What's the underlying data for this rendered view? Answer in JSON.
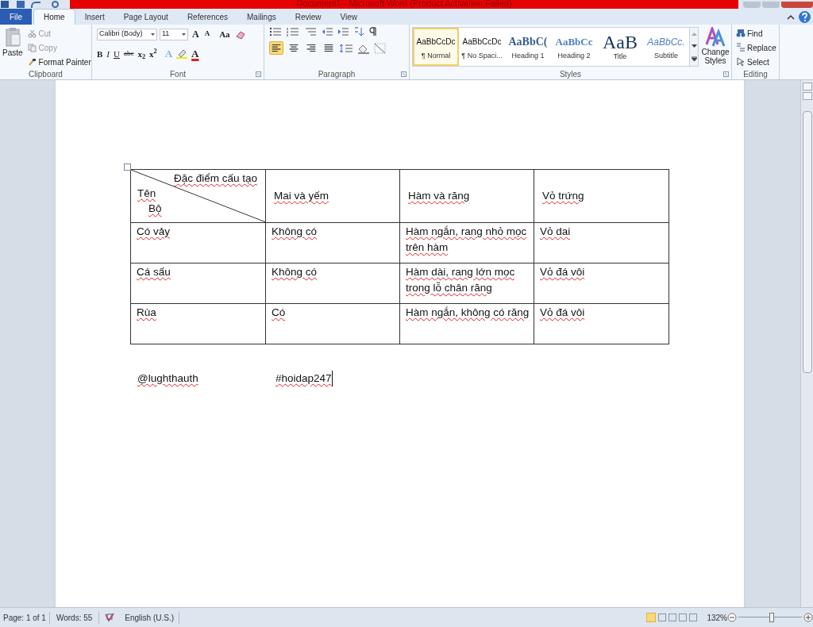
{
  "window": {
    "title": "Document1  -  Microsoft Word (Product Activation Failed)"
  },
  "tabs": [
    {
      "label": "File",
      "kind": "file",
      "selected": false
    },
    {
      "label": "Home",
      "kind": "tab",
      "selected": true
    },
    {
      "label": "Insert",
      "kind": "tab",
      "selected": false
    },
    {
      "label": "Page Layout",
      "kind": "tab",
      "selected": false
    },
    {
      "label": "References",
      "kind": "tab",
      "selected": false
    },
    {
      "label": "Mailings",
      "kind": "tab",
      "selected": false
    },
    {
      "label": "Review",
      "kind": "tab",
      "selected": false
    },
    {
      "label": "View",
      "kind": "tab",
      "selected": false
    }
  ],
  "clipboard": {
    "paste": "Paste",
    "cut": "Cut",
    "copy": "Copy",
    "format_painter": "Format Painter",
    "label": "Clipboard"
  },
  "font": {
    "font_name": "Calibri (Body)",
    "font_size": "11",
    "grow": "A",
    "shrink": "A",
    "change_case": "Aa",
    "bold": "B",
    "italic": "I",
    "underline": "U",
    "strikethrough": "abc",
    "subscript": "x$_{2}$",
    "superscript": "x$^{2}$",
    "text_effects": "A",
    "font_color": "A",
    "label": "Font"
  },
  "paragraph": {
    "alignments": [
      {
        "kind": "left",
        "selected": true
      },
      {
        "kind": "center",
        "selected": false
      },
      {
        "kind": "right",
        "selected": false
      },
      {
        "kind": "justify",
        "selected": false
      }
    ],
    "label": "Paragraph"
  },
  "styles": {
    "items": [
      {
        "preview": "AaBbCcDc",
        "label": "¶ Normal",
        "kind": "normal",
        "selected": true
      },
      {
        "preview": "AaBbCcDc",
        "label": "¶ No Spaci...",
        "kind": "normal",
        "selected": false
      },
      {
        "preview": "AaBbC(",
        "label": "Heading 1",
        "kind": "heading1",
        "selected": false
      },
      {
        "preview": "AaBbCc",
        "label": "Heading 2",
        "kind": "heading2",
        "selected": false
      },
      {
        "preview": "AaB",
        "label": "Title",
        "kind": "title",
        "selected": false
      },
      {
        "preview": "AaBbCc.",
        "label": "Subtitle",
        "kind": "subtitle",
        "selected": false
      }
    ],
    "change_styles": "Change Styles",
    "label": "Styles"
  },
  "editing": {
    "find": "Find",
    "replace": "Replace",
    "select": "Select",
    "label": "Editing"
  },
  "document": {
    "spelling_marks": true,
    "table": {
      "corner": {
        "top": "Đặc điểm cấu tạo",
        "left": "Tên",
        "bottom": "Bộ"
      },
      "columns": [
        "",
        "Mai và yếm",
        "Hàm và răng",
        "Vỏ trứng"
      ],
      "rows": [
        [
          "Có vảy",
          "Không có",
          "Hàm ngắn, rang nhỏ mọc trên hàm",
          "Vỏ dai"
        ],
        [
          "Cá sấu",
          "Không có",
          "Hàm dài, rang lớn mọc trong lỗ chân răng",
          "Vỏ đá vôi"
        ],
        [
          "Rùa",
          "Có",
          "Hàm ngắn, không có răng",
          "Vỏ đá vôi"
        ]
      ]
    },
    "footer": [
      "@lughthauth",
      "#hoidap247"
    ]
  },
  "status_bar": {
    "page": "Page: 1 of 1",
    "words": "Words: 55",
    "language": "English (U.S.)",
    "zoom": "132%",
    "zoom_slider": {
      "level": 0.53
    }
  }
}
